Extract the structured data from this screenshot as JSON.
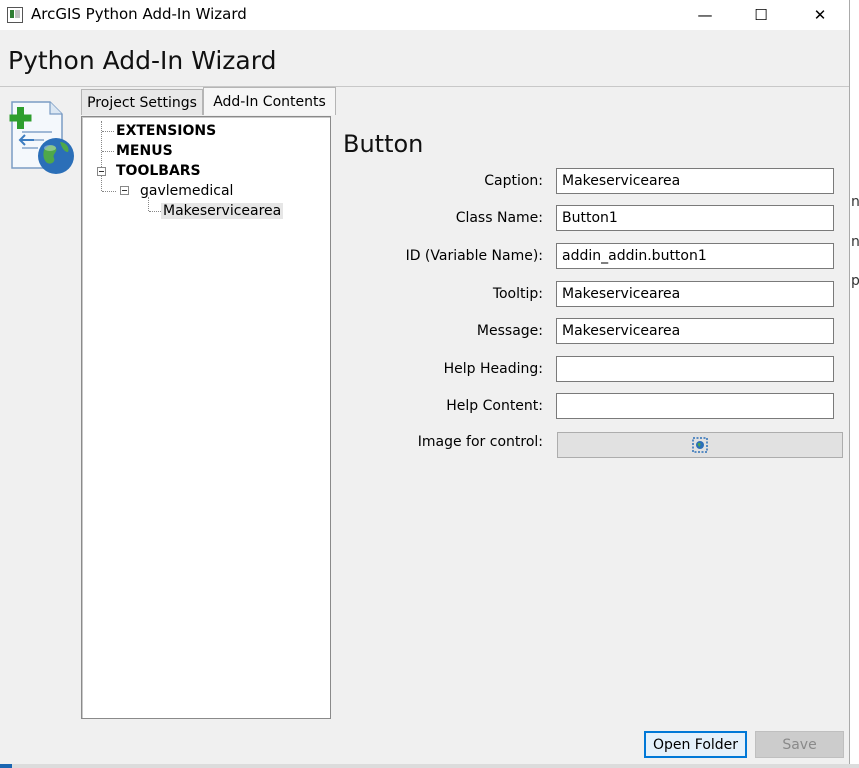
{
  "window": {
    "title": "ArcGIS Python Add-In Wizard",
    "minimize_glyph": "—",
    "maximize_glyph": "☐",
    "close_glyph": "✕"
  },
  "header": {
    "title": "Python Add-In Wizard"
  },
  "tabs": [
    {
      "label": "Project Settings",
      "active": false
    },
    {
      "label": "Add-In Contents",
      "active": true
    }
  ],
  "tree": {
    "extensions": "EXTENSIONS",
    "menus": "MENUS",
    "toolbars": "TOOLBARS",
    "toolbar": "gavlemedical",
    "button": "Makeservicearea"
  },
  "form": {
    "title": "Button",
    "fields": [
      {
        "label": "Caption:",
        "value": "Makeservicearea"
      },
      {
        "label": "Class Name:",
        "value": "Button1"
      },
      {
        "label": "ID (Variable Name):",
        "value": "addin_addin.button1"
      },
      {
        "label": "Tooltip:",
        "value": "Makeservicearea"
      },
      {
        "label": "Message:",
        "value": "Makeservicearea"
      },
      {
        "label": "Help Heading:",
        "value": ""
      },
      {
        "label": "Help Content:",
        "value": ""
      }
    ],
    "image_label": "Image for control:"
  },
  "buttons": {
    "open_folder": "Open Folder",
    "save": "Save"
  },
  "background_fragments": [
    "n",
    "n",
    "p"
  ],
  "colors": {
    "accent": "#0078d7",
    "window_bg": "#f0f0f0",
    "icon_green": "#2e9e2e",
    "icon_globe": "#2b6fb8"
  },
  "icons": {
    "app": "app-window-icon",
    "wizard": "addin-wizard-icon",
    "image_control": "control-image-icon"
  }
}
